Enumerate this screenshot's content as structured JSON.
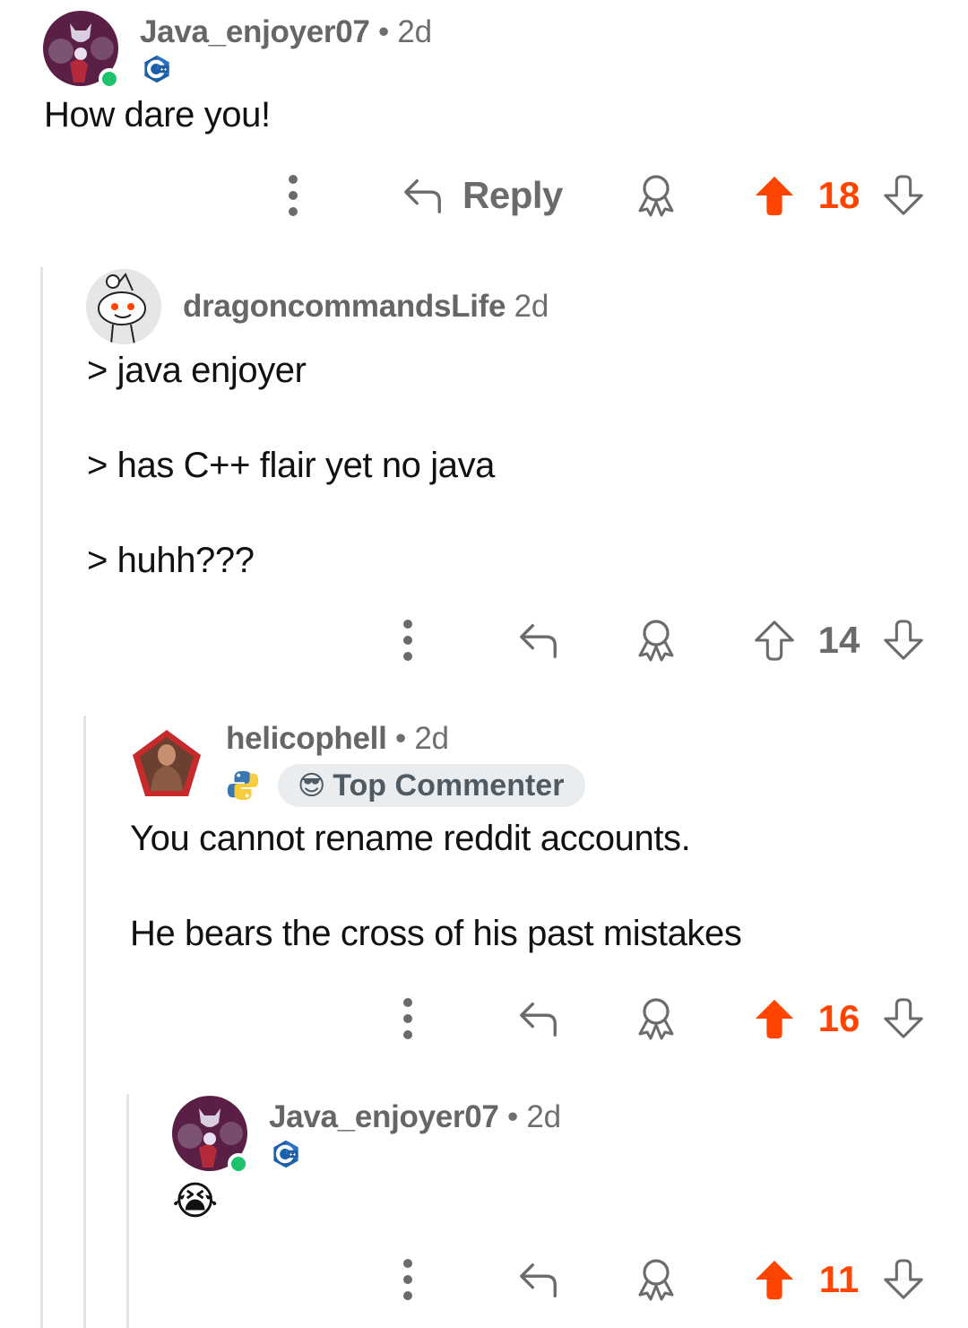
{
  "colors": {
    "upvote": "#ff4500",
    "icon_gray": "#6b6b6b",
    "online": "#1ec16c",
    "thread_line": "#e4e4e4",
    "badge_bg": "#eaedef"
  },
  "comments": [
    {
      "username": "Java_enjoyer07",
      "separator": "•",
      "age": "2d",
      "online": true,
      "flair": "cpp-flair-icon",
      "body": [
        "How dare you!"
      ],
      "actions": {
        "more": "more-options-icon",
        "reply_label": "Reply",
        "award": "award-icon"
      },
      "score": "18",
      "vote_state": "upvoted"
    },
    {
      "username": "dragoncommandsLife",
      "separator": "",
      "age": "2d",
      "online": false,
      "flair": null,
      "body": [
        "> java enjoyer",
        "> has C++ flair yet no java",
        "> huhh???"
      ],
      "actions": {
        "more": "more-options-icon",
        "award": "award-icon"
      },
      "score": "14",
      "vote_state": "none"
    },
    {
      "username": "helicophell",
      "separator": "•",
      "age": "2d",
      "online": false,
      "flair": "python-flair-icon",
      "badge": {
        "emoji": "😎",
        "label": "Top Commenter"
      },
      "body": [
        "You cannot rename reddit accounts.",
        "He bears the cross of his past mistakes"
      ],
      "actions": {
        "more": "more-options-icon",
        "award": "award-icon"
      },
      "score": "16",
      "vote_state": "upvoted"
    },
    {
      "username": "Java_enjoyer07",
      "separator": "•",
      "age": "2d",
      "online": true,
      "flair": "cpp-flair-icon",
      "body": [
        "😭"
      ],
      "actions": {
        "more": "more-options-icon",
        "award": "award-icon"
      },
      "score": "11",
      "vote_state": "upvoted"
    }
  ]
}
